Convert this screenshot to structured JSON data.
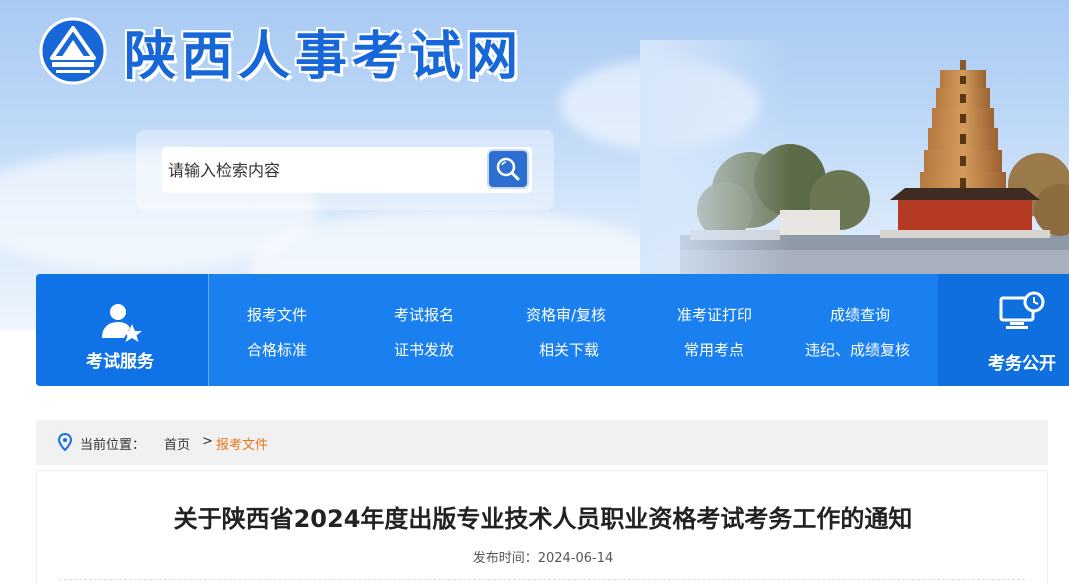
{
  "site": {
    "title": "陕西人事考试网"
  },
  "search": {
    "placeholder": "请输入检索内容"
  },
  "nav": {
    "service_label": "考试服务",
    "public_label": "考务公开",
    "links": [
      {
        "label": "报考文件"
      },
      {
        "label": "考试报名"
      },
      {
        "label": "资格审/复核"
      },
      {
        "label": "准考证打印"
      },
      {
        "label": "成绩查询"
      },
      {
        "label": "合格标准"
      },
      {
        "label": "证书发放"
      },
      {
        "label": "相关下载"
      },
      {
        "label": "常用考点"
      },
      {
        "label": "违纪、成绩复核"
      }
    ]
  },
  "breadcrumb": {
    "prefix": "当前位置：",
    "home": "首页",
    "separator": ">",
    "current": "报考文件"
  },
  "article": {
    "title": "关于陕西省2024年度出版专业技术人员职业资格考试考务工作的通知",
    "date_label": "发布时间：",
    "date_value": "2024-06-14"
  },
  "colors": {
    "brand_blue": "#1867d8",
    "nav_blue": "#1a80f0",
    "breadcrumb_current": "#e8761a"
  },
  "icons": {
    "logo": "mountain-emblem-icon",
    "search": "search-icon",
    "service": "user-star-icon",
    "public": "monitor-clock-icon",
    "location": "location-pin-icon"
  }
}
